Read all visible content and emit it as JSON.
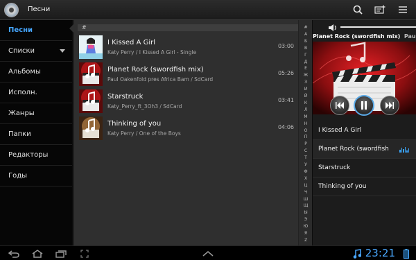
{
  "app": {
    "title": "Песни",
    "icon": "music-disc-icon"
  },
  "actionbar": {
    "icons": [
      "search-icon",
      "add-playlist-icon",
      "menu-icon"
    ]
  },
  "sidebar": {
    "items": [
      {
        "label": "Песни",
        "active": true
      },
      {
        "label": "Списки",
        "expandable": true
      },
      {
        "label": "Альбомы"
      },
      {
        "label": "Исполн."
      },
      {
        "label": "Жанры"
      },
      {
        "label": "Папки"
      },
      {
        "label": "Редакторы"
      },
      {
        "label": "Годы"
      }
    ]
  },
  "songlist": {
    "header": "#",
    "songs": [
      {
        "title": "I Kissed A Girl",
        "subtitle": "Katy Perry / I Kissed A Girl - Single",
        "duration": "03:00",
        "art": "album-art-pink"
      },
      {
        "title": "Planet Rock (swordfish mix)",
        "subtitle": "Paul Oakenfold pres Africa Bam / SdCard",
        "duration": "05:26",
        "art": "music-note-art"
      },
      {
        "title": "Starstruck",
        "subtitle": "Katy_Perry_ft_3Oh3 / SdCard",
        "duration": "03:41",
        "art": "music-note-art"
      },
      {
        "title": "Thinking of you",
        "subtitle": "Katy Perry / One of the Boys",
        "duration": "04:06",
        "art": "music-note-art-brown"
      }
    ]
  },
  "alphabet": [
    "#",
    "А",
    "Б",
    "В",
    "Г",
    "Д",
    "Е",
    "Ж",
    "З",
    "И",
    "Й",
    "К",
    "Л",
    "М",
    "Н",
    "О",
    "П",
    "Р",
    "С",
    "Т",
    "У",
    "Ф",
    "Х",
    "Ц",
    "Ч",
    "Ш",
    "Щ",
    "Ы",
    "Э",
    "Ю",
    "Я",
    "Z"
  ],
  "player": {
    "now_playing": "Planet Rock (swordfish mix)",
    "next_hint": "Paul O",
    "volume_level": 0.95,
    "controls": [
      "previous-icon",
      "pause-icon",
      "next-icon"
    ],
    "queue": [
      {
        "title": "I Kissed A Girl"
      },
      {
        "title": "Planet Rock (swordfish",
        "playing": true
      },
      {
        "title": "Starstruck"
      },
      {
        "title": "Thinking of you"
      }
    ]
  },
  "systembar": {
    "clock": "23:21",
    "icons": [
      "back-icon",
      "home-icon",
      "recent-apps-icon",
      "screenshot-icon",
      "up-arrow-icon",
      "music-note-icon",
      "battery-icon"
    ]
  },
  "colors": {
    "accent": "#46a7ff",
    "list_bg": "#2f2f2f"
  }
}
